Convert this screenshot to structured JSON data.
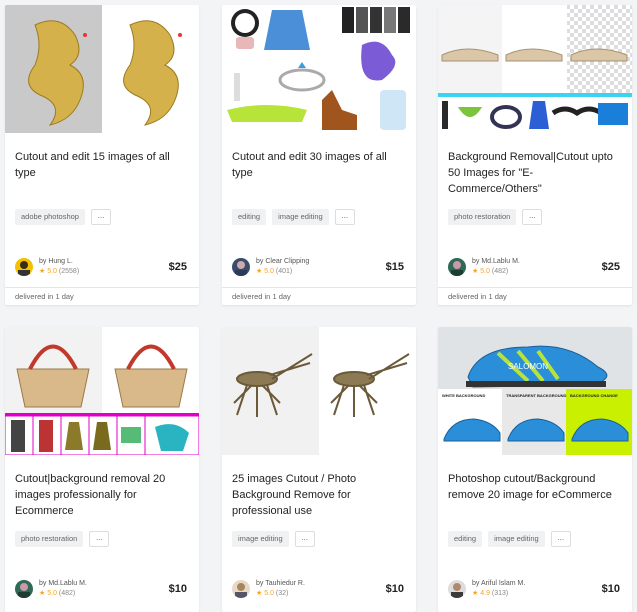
{
  "cards": [
    {
      "title": "Cutout and edit 15 images of all type",
      "tags": [
        "adobe photoshop"
      ],
      "more": "...",
      "seller": "by Hung L.",
      "rating": "5.0",
      "reviews": "(2558)",
      "price": "$25",
      "delivery": "delivered in 1 day"
    },
    {
      "title": "Cutout and edit 30 images of all type",
      "tags": [
        "editing",
        "image editing"
      ],
      "more": "...",
      "seller": "by Clear Clipping",
      "rating": "5.0",
      "reviews": "(401)",
      "price": "$15",
      "delivery": "delivered in 1 day"
    },
    {
      "title": "Background Removal|Cutout upto 50 Images for \"E-Commerce/Others\"",
      "tags": [
        "photo restoration"
      ],
      "more": "...",
      "seller": "by Md.Lablu M.",
      "rating": "5.0",
      "reviews": "(482)",
      "price": "$25",
      "delivery": "delivered in 1 day"
    },
    {
      "title": "Cutout|background removal 20 images professionally for Ecommerce",
      "tags": [
        "photo restoration"
      ],
      "more": "...",
      "seller": "by Md.Lablu M.",
      "rating": "5.0",
      "reviews": "(482)",
      "price": "$10"
    },
    {
      "title": "25 images Cutout / Photo Background Remove for professional use",
      "tags": [
        "image editing"
      ],
      "more": "...",
      "seller": "by Tauhiedur R.",
      "rating": "5.0",
      "reviews": "(32)",
      "price": "$10"
    },
    {
      "title": "Photoshop cutout/Background remove 20 image for eCommerce",
      "tags": [
        "editing",
        "image editing"
      ],
      "more": "...",
      "seller": "by Ariful Islam M.",
      "rating": "4.9",
      "reviews": "(313)",
      "price": "$10"
    }
  ],
  "thumbnail_labels": {
    "shoe_logo": "SALOMON",
    "shoe_labels": [
      "WHITE BACKGROUND",
      "TRANSPARENT BACKGROUND",
      "BACKGROUND CHANGE"
    ]
  },
  "colors": {
    "star": "#f5a623",
    "divider_pink": "#e100c8",
    "divider_cyan": "#3ad4f0"
  }
}
